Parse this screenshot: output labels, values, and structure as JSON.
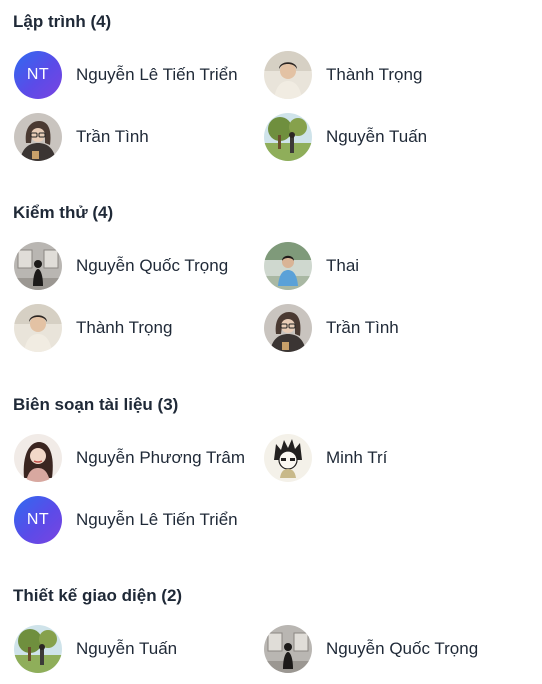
{
  "groups": [
    {
      "title": "Lập trình (4)",
      "members": [
        {
          "name": "Nguyễn Lê Tiến Triển",
          "initials": "NT",
          "avatar": "initials"
        },
        {
          "name": "Thành Trọng",
          "avatar": "photo-boy-sweater"
        },
        {
          "name": "Trần Tình",
          "avatar": "photo-girl-glasses"
        },
        {
          "name": "Nguyễn Tuấn",
          "avatar": "photo-outdoor-tree"
        }
      ]
    },
    {
      "title": "Kiểm thử (4)",
      "members": [
        {
          "name": "Nguyễn Quốc Trọng",
          "avatar": "photo-gallery-silhouette"
        },
        {
          "name": "Thai",
          "avatar": "photo-boy-outdoor"
        },
        {
          "name": "Thành Trọng",
          "avatar": "photo-boy-sweater"
        },
        {
          "name": "Trần Tình",
          "avatar": "photo-girl-glasses"
        }
      ]
    },
    {
      "title": "Biên soạn tài liệu (3)",
      "members": [
        {
          "name": "Nguyễn Phương Trâm",
          "avatar": "photo-girl-portrait"
        },
        {
          "name": "Minh Trí",
          "avatar": "photo-anime-sketch"
        },
        {
          "name": "Nguyễn Lê Tiến Triển",
          "initials": "NT",
          "avatar": "initials"
        }
      ]
    },
    {
      "title": "Thiết kế giao diện (2)",
      "members": [
        {
          "name": "Nguyễn Tuấn",
          "avatar": "photo-outdoor-tree"
        },
        {
          "name": "Nguyễn Quốc Trọng",
          "avatar": "photo-gallery-silhouette"
        }
      ]
    }
  ]
}
